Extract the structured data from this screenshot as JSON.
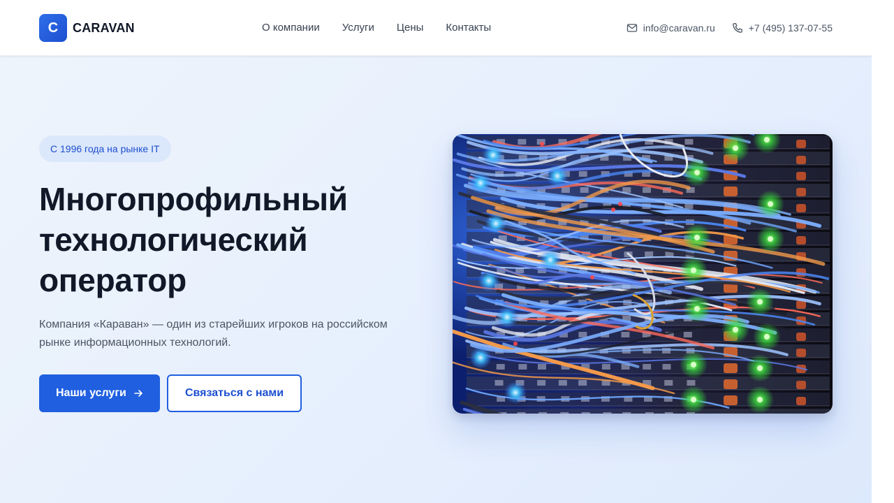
{
  "brand": {
    "logo_letter": "C",
    "name": "CARAVAN"
  },
  "nav": {
    "items": [
      {
        "label": "О компании"
      },
      {
        "label": "Услуги"
      },
      {
        "label": "Цены"
      },
      {
        "label": "Контакты"
      }
    ]
  },
  "contacts": {
    "email": "info@caravan.ru",
    "phone": "+7 (495) 137-07-55",
    "email_icon": "mail-icon",
    "phone_icon": "phone-icon"
  },
  "hero": {
    "badge": "С 1996 года на рынке IT",
    "title_lines": [
      "Многопрофильный",
      "технологический",
      "оператор"
    ],
    "subtitle_lines": [
      "Компания «Караван» — один из старейших игроков на российском",
      "рынке информационных технологий."
    ],
    "primary_button": "Наши услуги",
    "primary_button_icon": "arrow-right-icon",
    "secondary_button": "Связаться с нами",
    "image": "server-rack-photo"
  },
  "colors": {
    "accent": "#1f5fe0",
    "accent_dark": "#1d4fd0",
    "hero_bg": "#e8f0fc",
    "badge_bg": "#dbe7fb",
    "text": "#111827",
    "muted": "#4b5563"
  }
}
